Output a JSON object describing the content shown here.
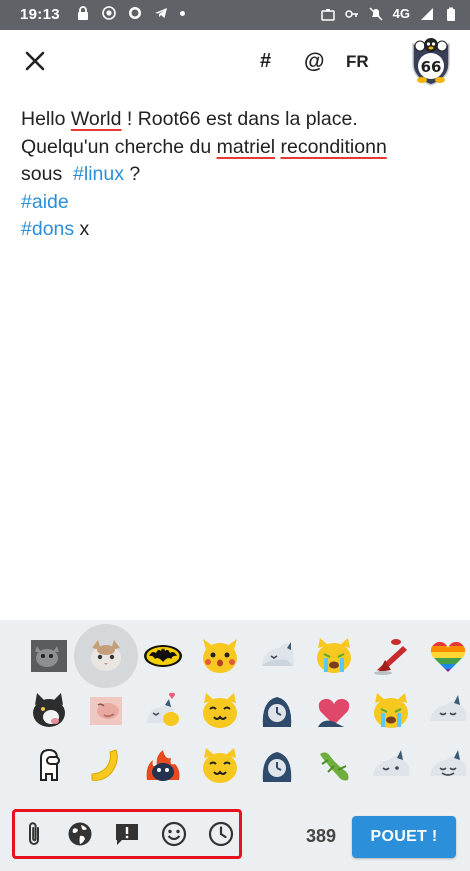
{
  "status_bar": {
    "time": "19:13",
    "network": "4G"
  },
  "toolbar": {
    "hashtag_label": "#",
    "mention_label": "@",
    "language_label": "FR"
  },
  "compose": {
    "line1": {
      "a": "Hello ",
      "b": "World",
      "c": " ! Root66 est dans la place."
    },
    "line2": {
      "a": "Quelqu'un cherche du ",
      "b": "matriel",
      "c": " ",
      "d": "reconditionn"
    },
    "line3": {
      "a": "sous  ",
      "b": "#linux",
      "c": " ?"
    },
    "line4": {
      "a": "#aide"
    },
    "line5": {
      "a": "#dons",
      "b": " x"
    }
  },
  "emoji_panel": {
    "rows": [
      [
        "cat-photo",
        "cat-photo-selected",
        "batman",
        "pikachu-face",
        "blob-shark",
        "crying-cat",
        "ketchup",
        "rainbow-heart"
      ],
      [
        "cat-photo-2",
        "pink-face",
        "shark-heart",
        "cat-w",
        "shark-clock",
        "shark-heart-2",
        "crying-cat-2",
        "blob-shark-2"
      ],
      [
        "among-us",
        "yellow-arm",
        "fire-tux",
        "cat-w-2",
        "shark-clock-2",
        "green-gecko",
        "blob-shark-3",
        "blob-shark-4"
      ]
    ]
  },
  "actions": {
    "character_count": "389",
    "toot_label": "POUET !",
    "tools": [
      "paperclip-icon",
      "globe-icon",
      "content-warning-icon",
      "emoji-icon",
      "clock-icon"
    ]
  },
  "colors": {
    "accent": "#2b90d9",
    "spellcheck": "#e53935",
    "highlight_box": "#e8121f",
    "statusbar": "#5f6368",
    "emoji_panel_bg": "#eceff1"
  }
}
